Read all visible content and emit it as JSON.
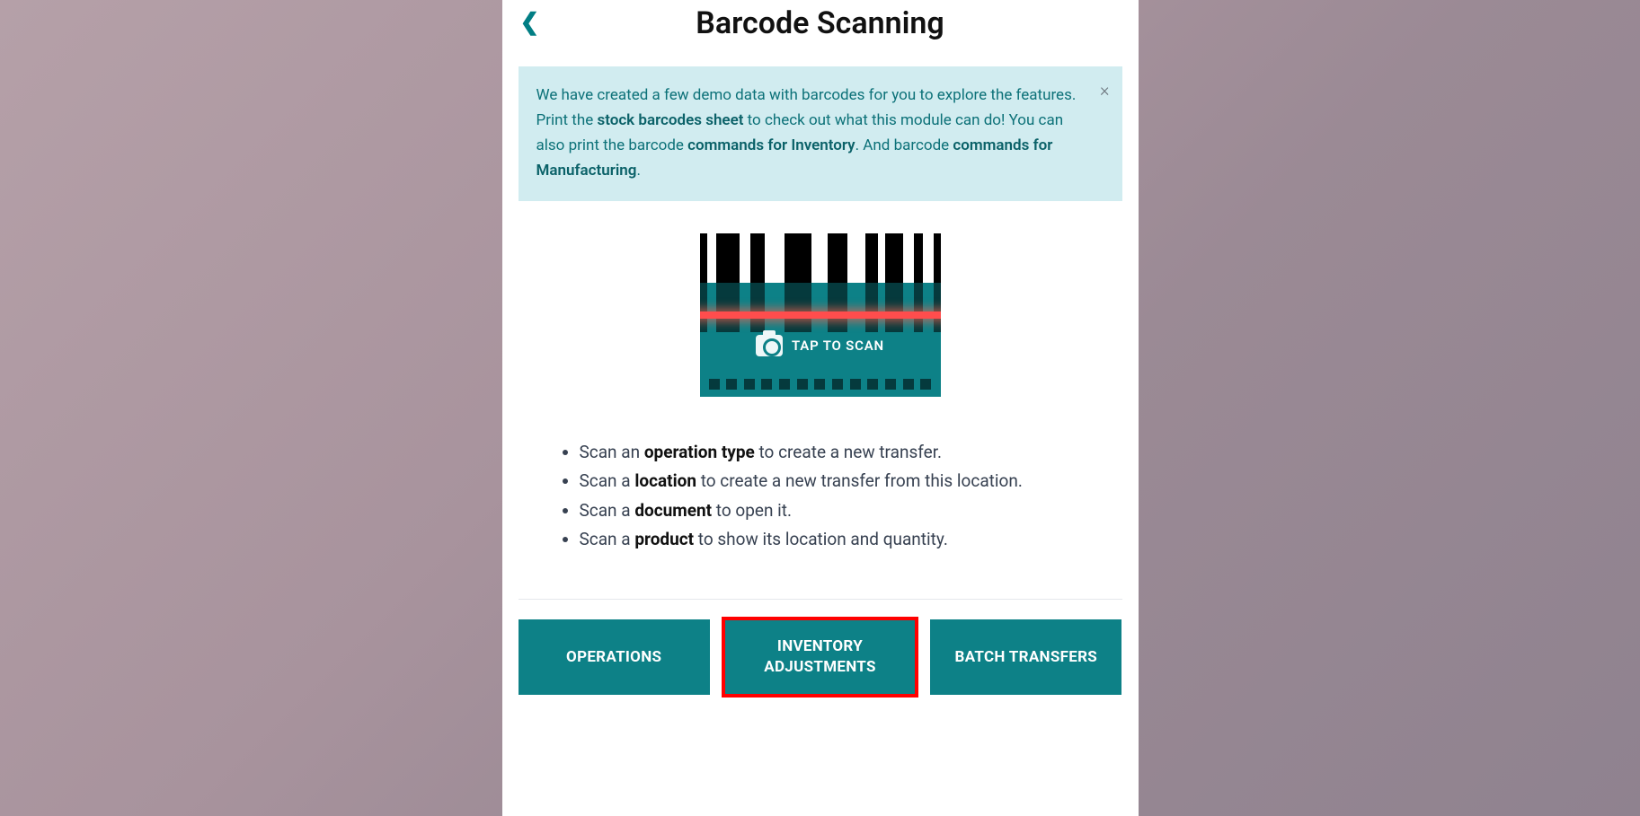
{
  "header": {
    "title": "Barcode Scanning"
  },
  "info": {
    "text_1": "We have created a few demo data with barcodes for you to explore the features. Print the ",
    "link_1": "stock barcodes sheet",
    "text_2": " to check out what this module can do! You can also print the barcode ",
    "link_2": "commands for Inventory",
    "text_3": ". And barcode ",
    "link_3": "commands for Manufacturing",
    "text_4": "."
  },
  "scan": {
    "tap_label": "TAP TO SCAN"
  },
  "instructions": {
    "items": [
      {
        "pre": "Scan an ",
        "bold": "operation type",
        "post": " to create a new transfer."
      },
      {
        "pre": "Scan a ",
        "bold": "location",
        "post": " to create a new transfer from this location."
      },
      {
        "pre": "Scan a ",
        "bold": "document",
        "post": " to open it."
      },
      {
        "pre": "Scan a ",
        "bold": "product",
        "post": " to show its location and quantity."
      }
    ]
  },
  "buttons": {
    "operations": "OPERATIONS",
    "inventory_adjustments": "INVENTORY ADJUSTMENTS",
    "batch_transfers": "BATCH TRANSFERS"
  },
  "colors": {
    "teal": "#0d8187",
    "info_bg": "#d1ecf0",
    "highlight": "#ff0000"
  }
}
